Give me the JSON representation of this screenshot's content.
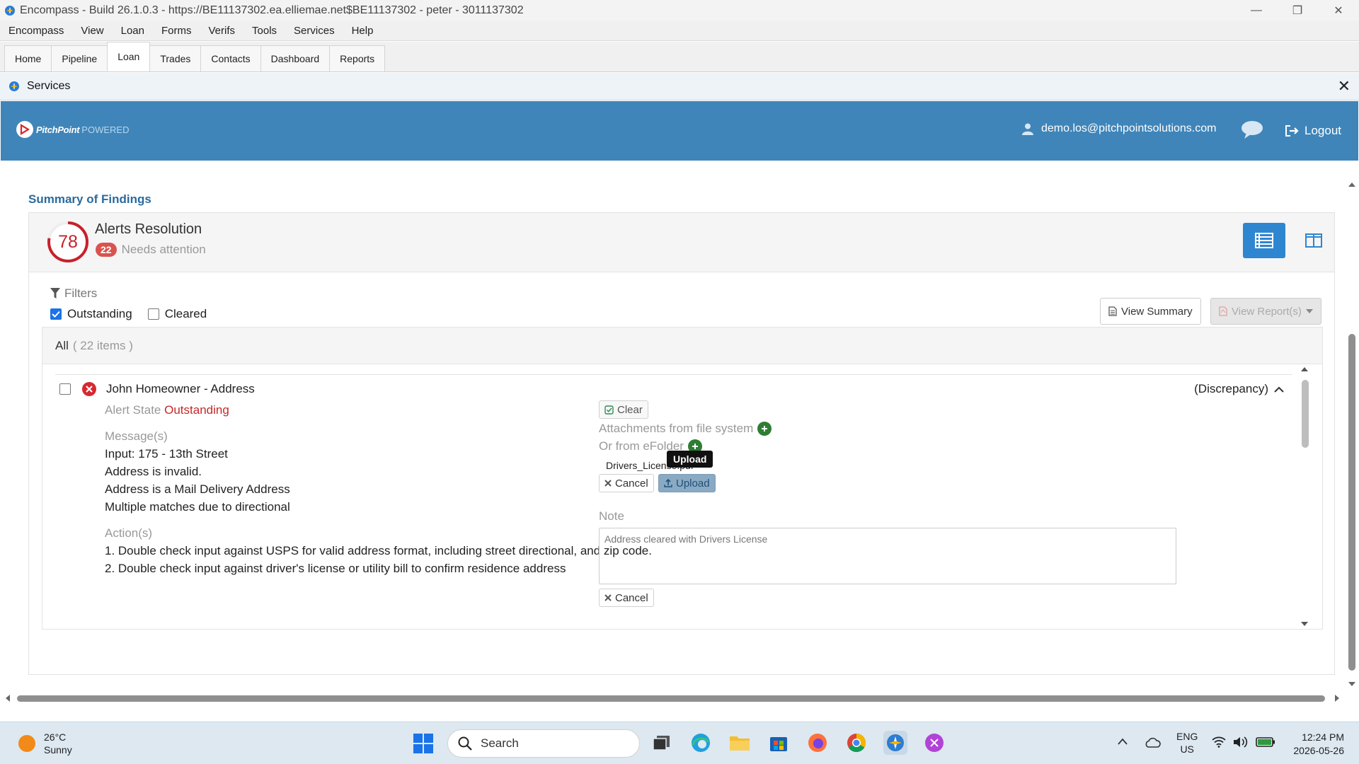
{
  "window": {
    "title": "Encompass - Build 26.1.0.3 - https://BE11137302.ea.elliemae.net$BE11137302 - peter - 3011137302",
    "minimize": "—",
    "restore": "❐",
    "close": "✕"
  },
  "menu": [
    "Encompass",
    "View",
    "Loan",
    "Forms",
    "Verifs",
    "Tools",
    "Services",
    "Help"
  ],
  "tabs": [
    "Home",
    "Pipeline",
    "Loan",
    "Trades",
    "Contacts",
    "Dashboard",
    "Reports"
  ],
  "active_tab": "Loan",
  "services_bar": {
    "title": "Services",
    "close": "✕"
  },
  "header": {
    "brand": "PitchPoint",
    "powered": "POWERED",
    "user_email": "demo.los@pitchpointsolutions.com",
    "logout_label": "Logout",
    "brand_color": "#3f85b9"
  },
  "summary": {
    "section_title": "Summary of Findings",
    "score": "78",
    "panel_title": "Alerts Resolution",
    "needs_count": "22",
    "needs_label": "Needs attention",
    "filters_label": "Filters",
    "outstanding_label": "Outstanding",
    "cleared_label": "Cleared",
    "view_summary_label": "View Summary",
    "view_reports_label": "View Report(s)",
    "list_all_label": "All",
    "list_count": "( 22 items )"
  },
  "alert": {
    "title": "John Homeowner - Address",
    "type": "(Discrepancy)",
    "state_label": "Alert State",
    "state_value": "Outstanding",
    "messages_label": "Message(s)",
    "messages": [
      "Input: 175 - 13th Street",
      "Address is invalid.",
      "Address is a Mail Delivery Address",
      "Multiple matches due to directional"
    ],
    "actions_label": "Action(s)",
    "actions": [
      "1. Double check input against USPS for valid address format, including street directional, and zip code.",
      "2. Double check input against driver's license or utility bill to confirm residence address"
    ],
    "clear_label": "Clear",
    "attachments_label": "Attachments from file system",
    "efolder_label": "Or from eFolder",
    "file_name": "Drivers_License.pdf",
    "tooltip": "Upload",
    "cancel_label": "Cancel",
    "upload_label": "Upload",
    "note_label": "Note",
    "note_value": "Address cleared with Drivers License",
    "note_cancel_label": "Cancel"
  },
  "taskbar": {
    "temperature": "26°C",
    "condition": "Sunny",
    "search_label": "Search",
    "lang": "ENG",
    "region": "US",
    "time": "12:24 PM",
    "date": "2026-05-26"
  }
}
